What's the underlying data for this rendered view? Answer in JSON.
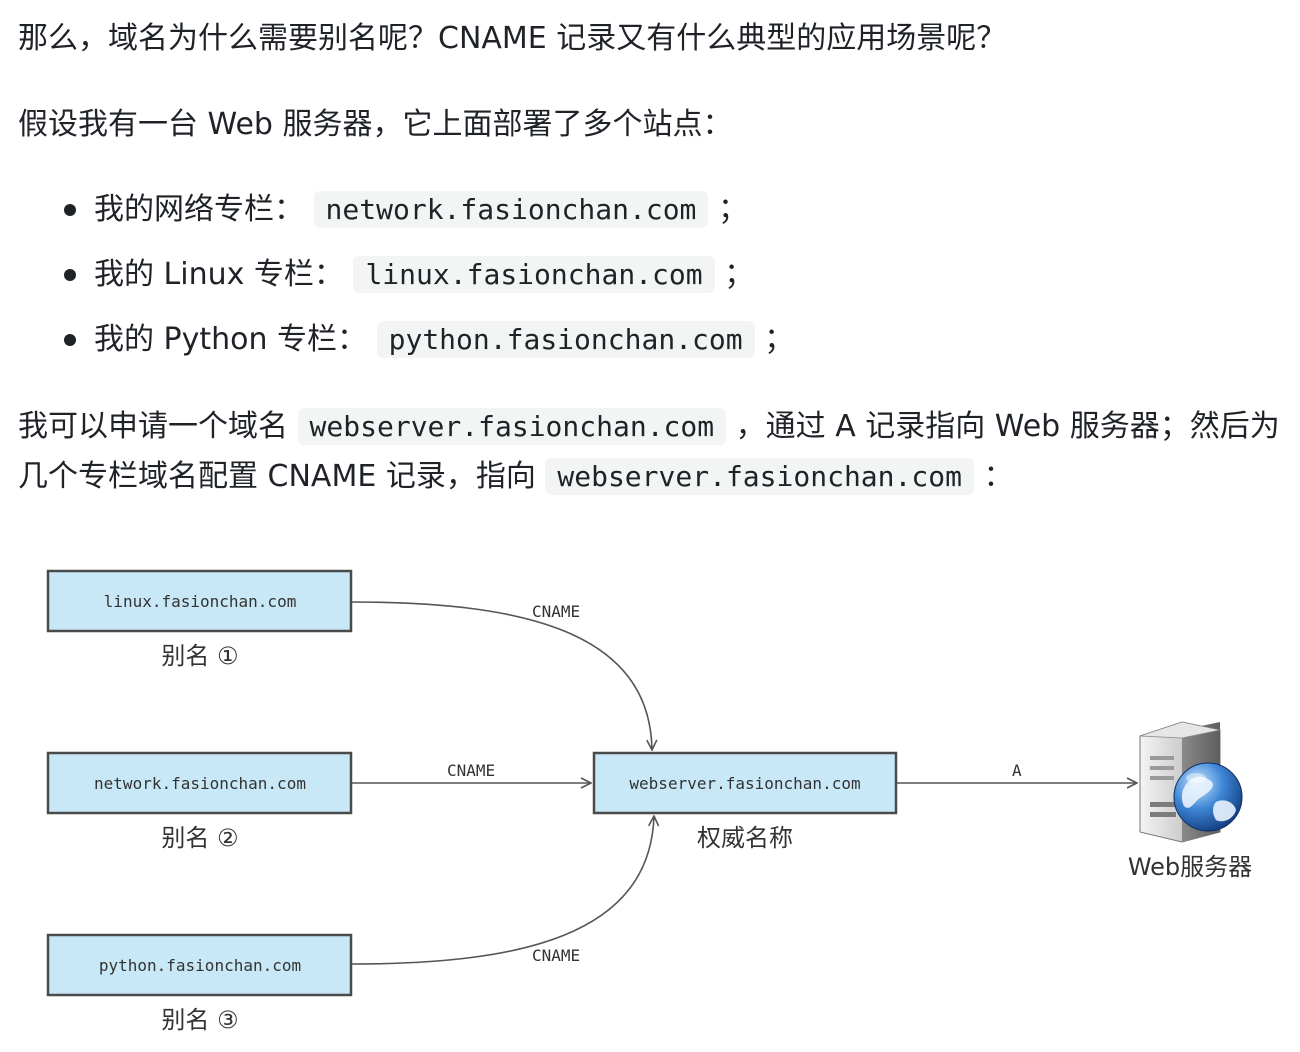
{
  "paragraphs": {
    "p1": "那么，域名为什么需要别名呢？CNAME 记录又有什么典型的应用场景呢？",
    "p2": "假设我有一台 Web 服务器，它上面部署了多个站点："
  },
  "bullets": [
    {
      "label": "我的网络专栏：",
      "code": "network.fasionchan.com",
      "suffix": "；"
    },
    {
      "label": "我的 Linux 专栏：",
      "code": "linux.fasionchan.com",
      "suffix": "；"
    },
    {
      "label": "我的 Python 专栏：",
      "code": "python.fasionchan.com",
      "suffix": "；"
    }
  ],
  "p3": {
    "line1_prefix": "我可以申请一个域名",
    "line1_code": "webserver.fasionchan.com",
    "line1_suffix": "，通过 A 记录指向 Web 服务器；然后为",
    "line2_prefix": "几个专栏域名配置 CNAME 记录，指向",
    "line2_code": "webserver.fasionchan.com",
    "line2_suffix": "："
  },
  "diagram": {
    "aliases": [
      {
        "domain": "linux.fasionchan.com",
        "caption": "别名 ①"
      },
      {
        "domain": "network.fasionchan.com",
        "caption": "别名 ②"
      },
      {
        "domain": "python.fasionchan.com",
        "caption": "别名 ③"
      }
    ],
    "canonical": {
      "domain": "webserver.fasionchan.com",
      "caption": "权威名称"
    },
    "edges": {
      "cname_1": "CNAME",
      "cname_2": "CNAME",
      "cname_3": "CNAME",
      "a": "A"
    },
    "server": {
      "caption": "Web服务器",
      "icon": "server-globe-icon"
    },
    "colors": {
      "box_fill": "#c9e8f7",
      "box_stroke": "#4a4a4a",
      "edge": "#555555"
    }
  }
}
